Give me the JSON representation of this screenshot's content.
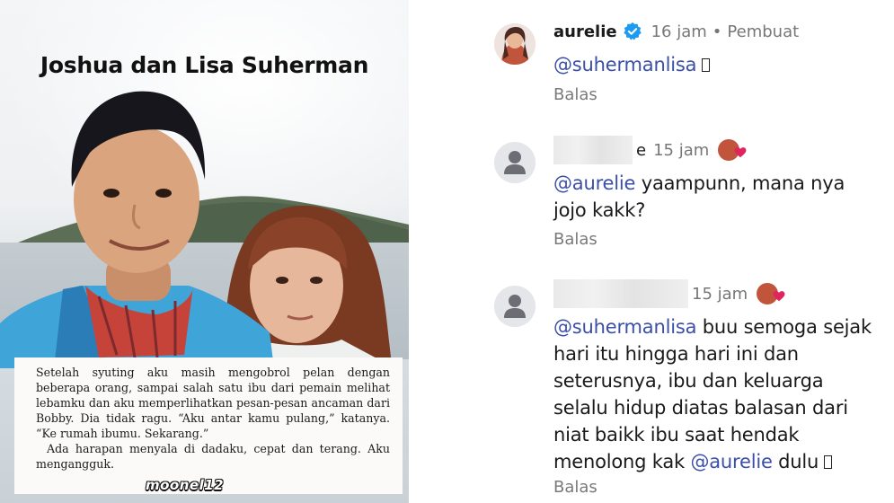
{
  "left_panel": {
    "title": "Joshua dan Lisa Suherman",
    "book_paragraphs": [
      "Setelah syuting aku masih mengobrol pelan dengan beberapa orang, sampai salah satu ibu dari pemain melihat lebamku dan aku memperlihatkan pesan-pesan ancaman dari Bobby. Dia tidak ragu. “Aku antar kamu pulang,” katanya. “Ke rumah ibumu. Sekarang.”",
      "Ada harapan menyala di dadaku, cepat dan terang. Aku mengangguk."
    ],
    "watermark": "moonel12"
  },
  "comments": [
    {
      "username": "aurelie",
      "verified": true,
      "time": "16 jam",
      "separator": "•",
      "role": "Pembuat",
      "mention": "@suhermanlisa",
      "text_after": "",
      "reply_label": "Balas",
      "avatar_icon": "profile-photo"
    },
    {
      "username": "",
      "time": "15 jam",
      "mention": "@aurelie",
      "text": " yaampunn, mana nya jojo kakk?",
      "reply_label": "Balas",
      "avatar_icon": "default-user-icon",
      "liked_by_creator": true
    },
    {
      "username": "",
      "time": "15 jam",
      "mention": "@suhermanlisa",
      "text": " buu semoga sejak hari itu hingga hari ini dan seterusnya, ibu dan keluarga selalu hidup diatas balasan dari niat baikk ibu saat hendak menolong kak ",
      "mention2": "@aurelie",
      "text2": " dulu",
      "reply_label": "Balas",
      "avatar_icon": "default-user-icon",
      "liked_by_creator": true
    }
  ],
  "colors": {
    "mention": "#3b4fa8",
    "verified": "#1d9bf0",
    "heart": "#e0245e",
    "muted": "#7a7a7a"
  }
}
